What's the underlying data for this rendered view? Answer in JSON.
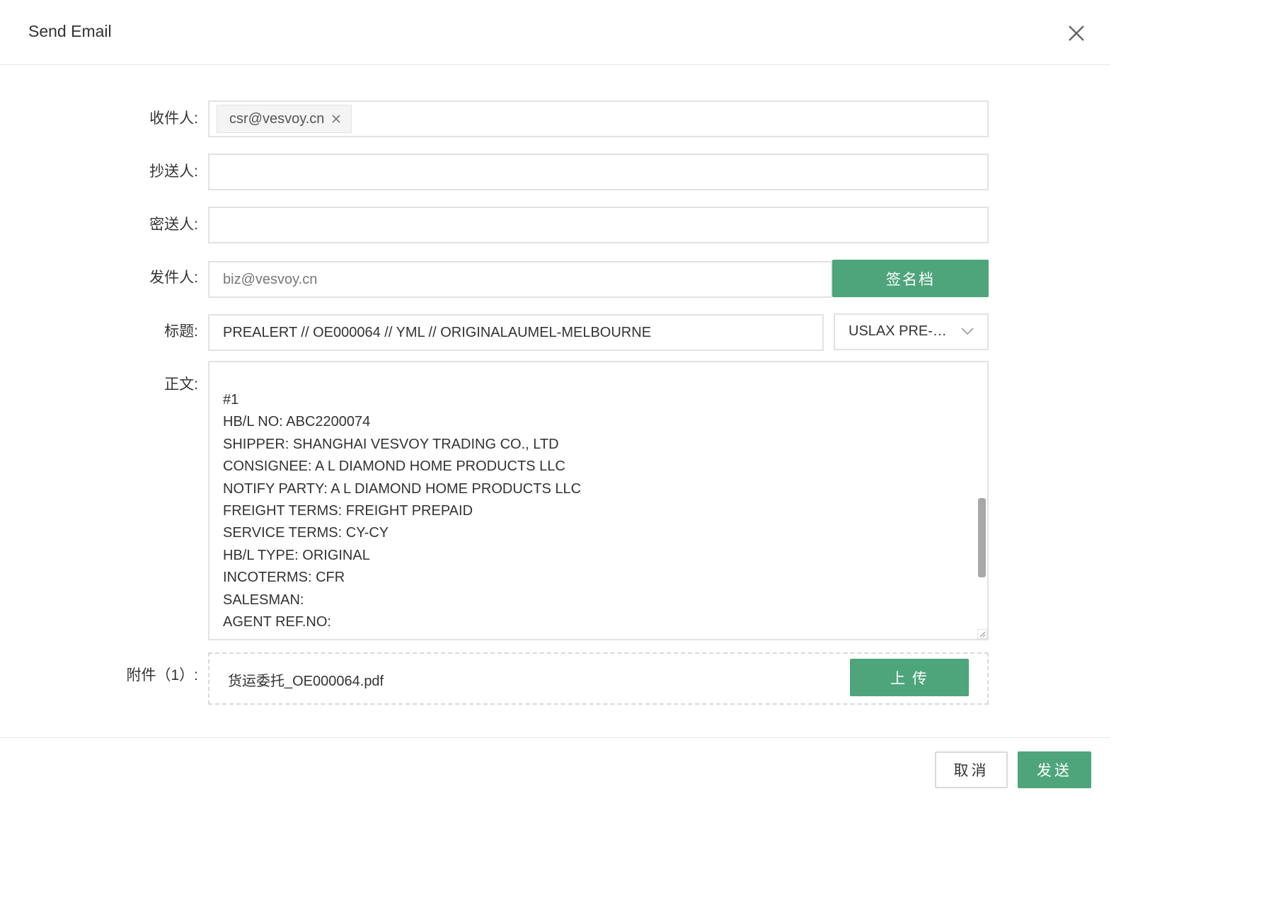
{
  "dialog": {
    "title": "Send Email",
    "close_icon": "close-icon"
  },
  "form": {
    "to": {
      "label": "收件人:",
      "tags": [
        "csr@vesvoy.cn"
      ]
    },
    "cc": {
      "label": "抄送人:",
      "value": ""
    },
    "bcc": {
      "label": "密送人:",
      "value": ""
    },
    "from": {
      "label": "发件人:",
      "value": "biz@vesvoy.cn",
      "signature_button": "签名档"
    },
    "subject": {
      "label": "标题:",
      "value": "PREALERT // OE000064 // YML // ORIGINALAUMEL-MELBOURNE",
      "template_select": "USLAX PRE-…"
    },
    "body": {
      "label": "正文:",
      "lines": [
        "#1",
        "HB/L NO: ABC2200074",
        "SHIPPER: SHANGHAI VESVOY TRADING CO., LTD",
        "CONSIGNEE: A L DIAMOND HOME PRODUCTS LLC",
        "NOTIFY PARTY: A L DIAMOND HOME PRODUCTS LLC",
        "FREIGHT TERMS: FREIGHT PREPAID",
        "SERVICE TERMS: CY-CY",
        "HB/L TYPE: ORIGINAL",
        "INCOTERMS: CFR",
        "SALESMAN:",
        "AGENT REF.NO:"
      ]
    },
    "attachments": {
      "label": "附件（1）:",
      "files": [
        "货运委托_OE000064.pdf"
      ],
      "upload_button": "上 传"
    }
  },
  "footer": {
    "cancel_button": "取消",
    "send_button": "发送"
  },
  "colors": {
    "accent": "#4ea57b",
    "border": "#e2e2e2",
    "text": "#333333"
  }
}
